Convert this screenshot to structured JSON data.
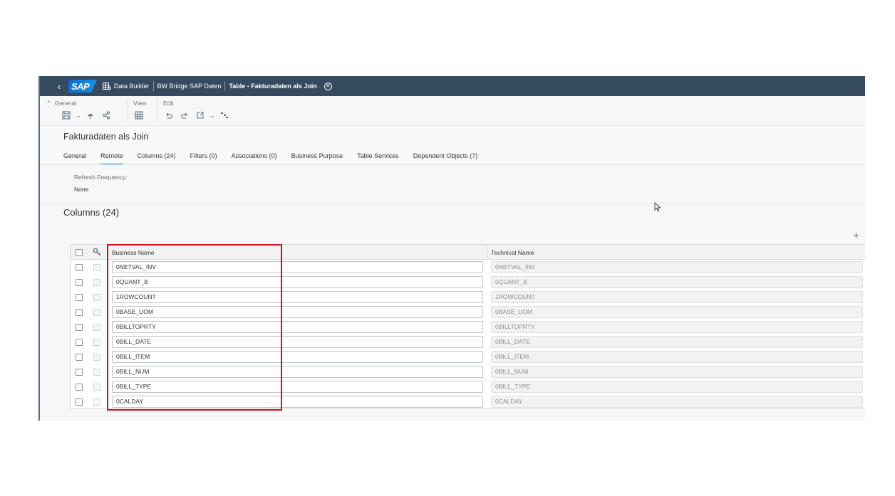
{
  "shell": {
    "back_icon": "chevron-left-icon",
    "logo": "SAP",
    "breadcrumb": [
      "Data Builder",
      "BW Bridge SAP Daten",
      "Table - Fakturadaten als Join"
    ],
    "close_icon": "close-circle-icon"
  },
  "toolbar": {
    "groups": [
      {
        "label": "General",
        "icons": [
          "save-icon",
          "deploy-icon",
          "share-icon"
        ]
      },
      {
        "label": "View",
        "icons": [
          "table-view-icon"
        ]
      },
      {
        "label": "Edit",
        "icons": [
          "undo-icon",
          "redo-icon",
          "export-icon",
          "impact-lineage-icon"
        ]
      }
    ]
  },
  "page": {
    "title": "Fakturadaten als Join",
    "tabs": [
      "General",
      "Remote",
      "Columns (24)",
      "Filters (0)",
      "Associations (0)",
      "Business Purpose",
      "Table Services",
      "Dependent Objects (?)"
    ],
    "active_tab": "Remote"
  },
  "remote": {
    "refresh_label": "Refresh Frequency:",
    "refresh_value": "None"
  },
  "columns": {
    "title": "Columns (24)",
    "add_icon": "plus-icon",
    "headers": {
      "business_name": "Business Name",
      "technical_name": "Technical Name"
    },
    "rows": [
      {
        "business": "0NETVAL_INV",
        "technical": "0NETVAL_INV"
      },
      {
        "business": "0QUANT_B",
        "technical": "0QUANT_B"
      },
      {
        "business": "1ROWCOUNT",
        "technical": "1ROWCOUNT"
      },
      {
        "business": "0BASE_UOM",
        "technical": "0BASE_UOM"
      },
      {
        "business": "0BILLTOPRTY",
        "technical": "0BILLTOPRTY"
      },
      {
        "business": "0BILL_DATE",
        "technical": "0BILL_DATE"
      },
      {
        "business": "0BILL_ITEM",
        "technical": "0BILL_ITEM"
      },
      {
        "business": "0BILL_NUM",
        "technical": "0BILL_NUM"
      },
      {
        "business": "0BILL_TYPE",
        "technical": "0BILL_TYPE"
      },
      {
        "business": "0CALDAY",
        "technical": "0CALDAY"
      }
    ]
  },
  "colors": {
    "shell": "#354a5f",
    "accent": "#0a6ed1",
    "highlight": "#d0101c"
  }
}
